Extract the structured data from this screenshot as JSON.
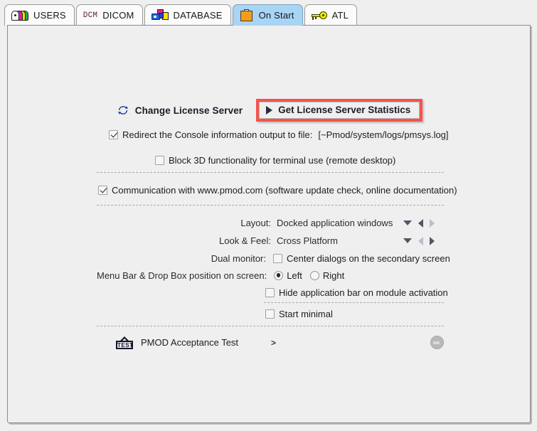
{
  "tabs": [
    {
      "id": "users",
      "label": "USERS",
      "icon": "users-stack-icon",
      "selected": false
    },
    {
      "id": "dicom",
      "label": "DICOM",
      "icon": "dcm-text-icon",
      "badge": "DCM",
      "selected": false
    },
    {
      "id": "database",
      "label": "DATABASE",
      "icon": "database-icon",
      "selected": false
    },
    {
      "id": "onstart",
      "label": "On Start",
      "icon": "inbox-arrow-icon",
      "selected": true
    },
    {
      "id": "atl",
      "label": "ATL",
      "icon": "key-icon",
      "selected": false
    }
  ],
  "license": {
    "change_label": "Change License Server",
    "change_icon": "refresh-circular-arrows-icon",
    "stats_label": "Get License Server Statistics",
    "stats_icon": "play-triangle-icon",
    "highlight_color": "#f2544c"
  },
  "options": {
    "redirect_console": {
      "label": "Redirect the Console information output to file:",
      "path": "[~Pmod/system/logs/pmsys.log]",
      "checked": true
    },
    "block_3d": {
      "label": "Block 3D functionality for terminal use (remote desktop)",
      "checked": false
    },
    "communication": {
      "label": "Communication with www.pmod.com (software update check, online documentation)",
      "checked": true
    },
    "hide_app_bar": {
      "label": "Hide application bar on module activation",
      "checked": false
    },
    "start_minimal": {
      "label": "Start minimal",
      "checked": false
    }
  },
  "settings": {
    "layout": {
      "label": "Layout:",
      "value": "Docked application windows",
      "prev_enabled": true,
      "next_enabled": false
    },
    "look_feel": {
      "label": "Look & Feel:",
      "value": "Cross Platform",
      "prev_enabled": false,
      "next_enabled": true
    },
    "dual_monitor": {
      "label": "Dual monitor:",
      "checkbox_label": "Center dialogs on the secondary screen",
      "checked": false
    },
    "menu_bar_position": {
      "label": "Menu Bar & Drop Box position on screen:",
      "left_label": "Left",
      "right_label": "Right",
      "selected": "Left"
    }
  },
  "acceptance_test": {
    "icon": "test-sign-icon",
    "icon_text": "TEST",
    "label": "PMOD Acceptance Test",
    "arrow": ">",
    "action_icon": "stop-round-button-icon"
  }
}
